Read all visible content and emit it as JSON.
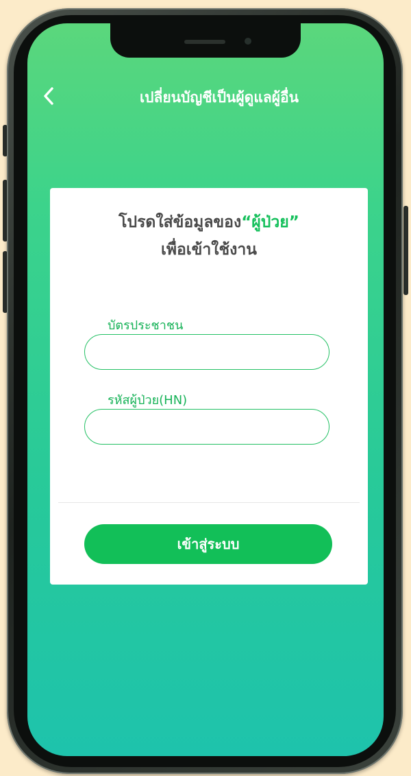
{
  "header": {
    "title": "เปลี่ยนบัญชีเป็นผู้ดูแลผู้อื่น",
    "back_icon": "chevron-left-icon"
  },
  "form": {
    "heading_prefix": "โปรดใส่ข้อมูลของ",
    "heading_highlight": "“ผู้ป่วย”",
    "heading_line2": "เพื่อเข้าใช้งาน",
    "id_card_label": "บัตรประชาชน",
    "id_card_value": "",
    "hn_label": "รหัสผู้ป่วย(HN)",
    "hn_value": "",
    "submit_label": "เข้าสู่ระบบ"
  },
  "colors": {
    "accent": "#12bf58",
    "gradient_top": "#5bd77c",
    "gradient_bottom": "#1ec3ac",
    "background": "#fcebc9"
  }
}
